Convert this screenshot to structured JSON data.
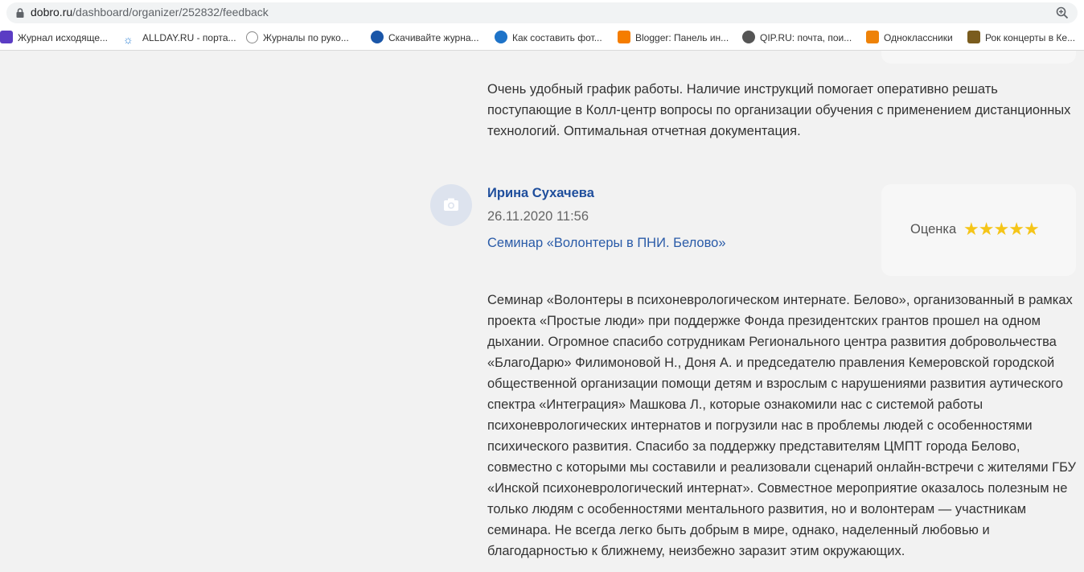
{
  "address_bar": {
    "url_host": "dobro.ru",
    "url_path": "/dashboard/organizer/252832/feedback"
  },
  "bookmarks": [
    {
      "label": "Журнал исходяще...",
      "icon": "list-icon",
      "color": "#5b3cc4"
    },
    {
      "label": "ALLDAY.RU - порта...",
      "icon": "sun-icon",
      "color": "#2a7fd4"
    },
    {
      "label": "Журналы по руко...",
      "icon": "clock-icon",
      "color": "#888888"
    },
    {
      "label": "Скачивайте журна...",
      "icon": "globe-icon",
      "color": "#1a56a8"
    },
    {
      "label": "Как составить фот...",
      "icon": "edge-icon",
      "color": "#1e73c8"
    },
    {
      "label": "Blogger: Панель ин...",
      "icon": "blogger-icon",
      "color": "#f57d00"
    },
    {
      "label": "QIP.RU: почта, пои...",
      "icon": "globe-icon",
      "color": "#555555"
    },
    {
      "label": "Одноклассники",
      "icon": "ok-icon",
      "color": "#ee8208"
    },
    {
      "label": "Рок концерты в Ке...",
      "icon": "rock-icon",
      "color": "#7a5c1e"
    }
  ],
  "prev_review": {
    "text": "Очень удобный график работы. Наличие инструкций помогает оперативно решать поступающие в Колл-центр вопросы по организации обучения с применением дистанционных технологий. Оптимальная отчетная документация."
  },
  "review": {
    "author": "Ирина Сухачева",
    "date": "26.11.2020 11:56",
    "event": "Семинар «Волонтеры в ПНИ. Белово»",
    "rating_label": "Оценка",
    "rating": 5,
    "rating_max": 5,
    "text": "Семинар «Волонтеры в психоневрологическом интернате. Белово», организованный в рамках проекта «Простые люди» при поддержке Фонда президентских грантов прошел на одном дыхании. Огромное спасибо сотрудникам Регионального центра развития добровольчества «БлагоДарю» Филимоновой Н., Доня А. и председателю правления Кемеровской городской общественной организации помощи детям и взрослым с нарушениями развития аутического спектра «Интеграция» Машкова Л., которые ознакомили нас с системой работы психоневрологических интернатов и погрузили нас в проблемы людей с особенностями психического развития. Спасибо за поддержку представителям ЦМПТ города Белово, совместно с которыми мы составили и реализовали сценарий онлайн-встречи с жителями ГБУ «Инской психоневрологический интернат». Совместное мероприятие оказалось полезным не только людям с особенностями ментального развития, но и волонтерам — участникам семинара. Не всегда легко быть добрым в мире, однако, наделенный любовью и благодарностью к ближнему, неизбежно заразит этим окружающих."
  },
  "colors": {
    "star": "#f5c518",
    "author_link": "#1f4e9c",
    "event_link": "#2a5ba8"
  }
}
